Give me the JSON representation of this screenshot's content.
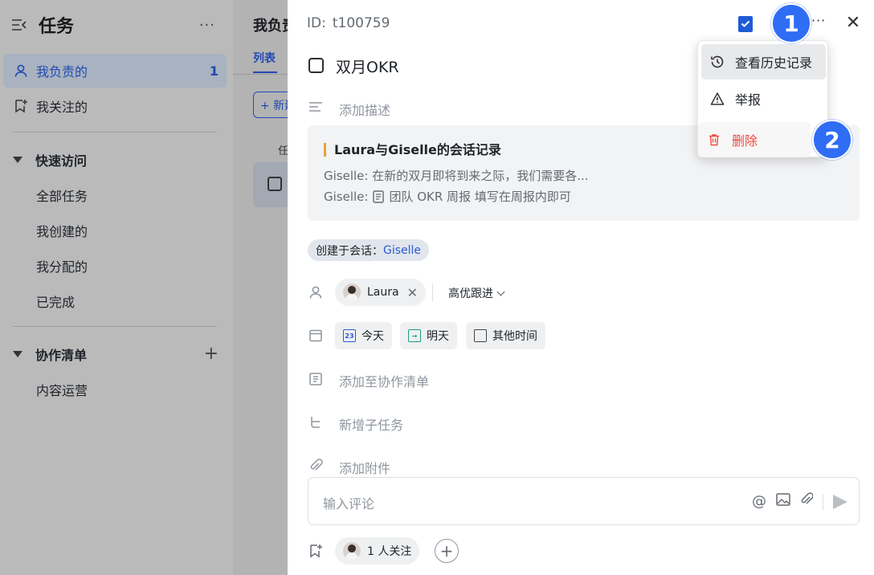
{
  "sidebar": {
    "title": "任务",
    "more": "···",
    "items": [
      {
        "label": "我负责的",
        "count": "1"
      },
      {
        "label": "我关注的"
      }
    ],
    "quick_access": {
      "label": "快速访问",
      "items": [
        "全部任务",
        "我创建的",
        "我分配的",
        "已完成"
      ]
    },
    "collab": {
      "label": "协作清单",
      "add": "+",
      "items": [
        "内容运营"
      ]
    }
  },
  "middle": {
    "title": "我负责的",
    "tab": "列表",
    "new_button": "+ 新建",
    "column_header": "任"
  },
  "detail": {
    "id_label": "ID:",
    "id_value": "t100759",
    "more": "···",
    "close": "✕",
    "title": "双月OKR",
    "description_placeholder": "添加描述",
    "card": {
      "title": "Laura与Giselle的会话记录",
      "line1": "Giselle: 在新的双月即将到来之际，我们需要各...",
      "line2_prefix": "Giselle:",
      "line2_text": "团队 OKR 周报 填写在周报内即可"
    },
    "source_prefix": "创建于会话：",
    "source_link": "Giselle",
    "assignee": "Laura",
    "priority": "高优跟进",
    "dates": {
      "today": "今天",
      "today_day": "23",
      "tomorrow": "明天",
      "other": "其他时间"
    },
    "add_to_list": "添加至协作清单",
    "add_subtask": "新增子任务",
    "add_attachment": "添加附件",
    "comment_placeholder": "输入评论",
    "followers": "1 人关注",
    "add_follower": "+"
  },
  "menu": {
    "items": [
      {
        "label": "查看历史记录"
      },
      {
        "label": "举报"
      },
      {
        "label": "删除"
      }
    ]
  },
  "badges": [
    "1",
    "2"
  ],
  "colors": {
    "accent": "#2f6df5",
    "danger": "#f04a41",
    "link": "#2a5bd6"
  }
}
